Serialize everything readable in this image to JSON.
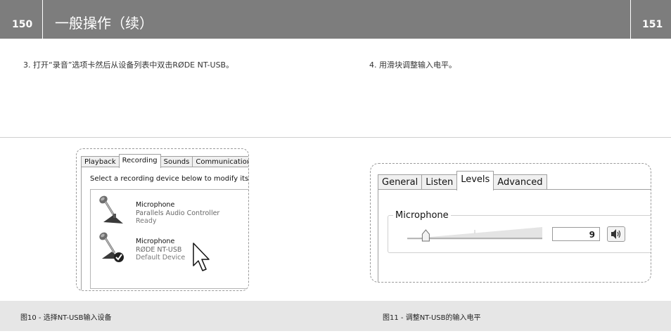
{
  "header": {
    "page_left": "150",
    "page_right": "151",
    "title": "一般操作（续）"
  },
  "steps": {
    "step3": "3. 打开“录音”选项卡然后从设备列表中双击RØDE NT-USB。",
    "step4": "4. 用滑块调整输入电平。"
  },
  "figure10": {
    "tabs": [
      "Playback",
      "Recording",
      "Sounds",
      "Communications"
    ],
    "active_tab": "Recording",
    "description": "Select a recording device below to modify its",
    "devices": [
      {
        "name": "Microphone",
        "driver": "Parallels Audio Controller",
        "status": "Ready",
        "default": false
      },
      {
        "name": "Microphone",
        "driver": "RØDE NT-USB",
        "status": "Default Device",
        "default": true
      }
    ],
    "caption": "图10 - 选择NT-USB输入设备"
  },
  "figure11": {
    "tabs": [
      "General",
      "Listen",
      "Levels",
      "Advanced"
    ],
    "active_tab": "Levels",
    "group_label": "Microphone",
    "level_value": "9",
    "slider_level_percent": 9,
    "caption": "图11 - 调整NT-USB的输入电平"
  },
  "colors": {
    "header_bg": "#7d7d7d",
    "caption_bg": "#e6e6e6"
  }
}
